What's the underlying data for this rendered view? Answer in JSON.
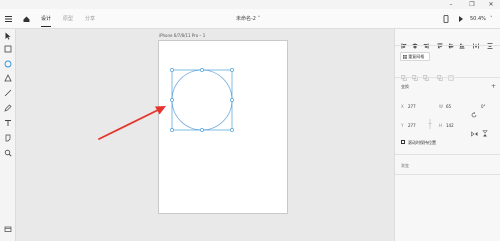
{
  "toolbar": {
    "tab_design": "设计",
    "tab_prototype": "原型",
    "tab_share": "分享",
    "doc_title": "未命名-2 ˅",
    "zoom": "50.4%",
    "zoom_chevron": "˅"
  },
  "artboard": {
    "label": "iPhone 6/7/8/11 Pro – 1"
  },
  "panel": {
    "group_button": "重复网格",
    "section_label": "变换",
    "x_label": "X",
    "x_value": "277",
    "w_label": "W",
    "w_value": "65",
    "rotate_value": "0°",
    "y_label": "Y",
    "y_value": "277",
    "h_label": "H",
    "h_value": "142",
    "checkbox_label": "滚动时保持位置",
    "bottom_label": "渐变"
  },
  "colors": {
    "accent": "#2e8fd6",
    "arrow": "#e8332a"
  }
}
